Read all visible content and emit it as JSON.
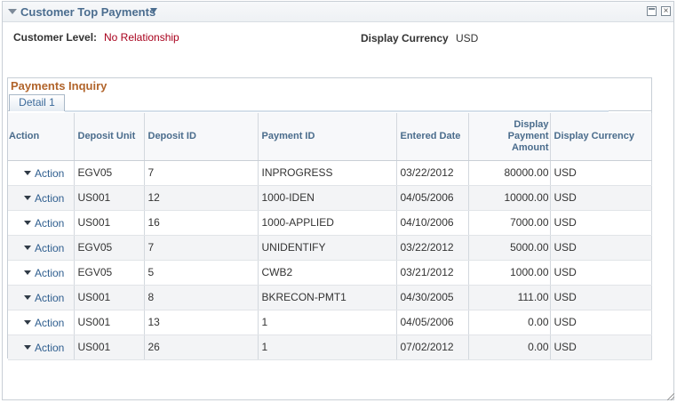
{
  "pagelet": {
    "title": "Customer Top Payments"
  },
  "info": {
    "customer_level_label": "Customer Level:",
    "customer_level_value": "No Relationship",
    "display_currency_label": "Display Currency",
    "display_currency_value": "USD"
  },
  "section": {
    "title": "Payments Inquiry",
    "tab_label": "Detail 1"
  },
  "grid": {
    "headers": {
      "action": "Action",
      "deposit_unit": "Deposit Unit",
      "deposit_id": "Deposit ID",
      "payment_id": "Payment ID",
      "entered_date": "Entered Date",
      "amount": "Display Payment Amount",
      "currency": "Display Currency"
    },
    "rows": [
      {
        "action": "Action",
        "deposit_unit": "EGV05",
        "deposit_id": "7",
        "payment_id": "INPROGRESS",
        "entered_date": "03/22/2012",
        "amount": "80000.00",
        "currency": "USD"
      },
      {
        "action": "Action",
        "deposit_unit": "US001",
        "deposit_id": "12",
        "payment_id": "1000-IDEN",
        "entered_date": "04/05/2006",
        "amount": "10000.00",
        "currency": "USD"
      },
      {
        "action": "Action",
        "deposit_unit": "US001",
        "deposit_id": "16",
        "payment_id": "1000-APPLIED",
        "entered_date": "04/10/2006",
        "amount": "7000.00",
        "currency": "USD"
      },
      {
        "action": "Action",
        "deposit_unit": "EGV05",
        "deposit_id": "7",
        "payment_id": "UNIDENTIFY",
        "entered_date": "03/22/2012",
        "amount": "5000.00",
        "currency": "USD"
      },
      {
        "action": "Action",
        "deposit_unit": "EGV05",
        "deposit_id": "5",
        "payment_id": "CWB2",
        "entered_date": "03/21/2012",
        "amount": "1000.00",
        "currency": "USD"
      },
      {
        "action": "Action",
        "deposit_unit": "US001",
        "deposit_id": "8",
        "payment_id": "BKRECON-PMT1",
        "entered_date": "04/30/2005",
        "amount": "111.00",
        "currency": "USD"
      },
      {
        "action": "Action",
        "deposit_unit": "US001",
        "deposit_id": "13",
        "payment_id": "1",
        "entered_date": "04/05/2006",
        "amount": "0.00",
        "currency": "USD"
      },
      {
        "action": "Action",
        "deposit_unit": "US001",
        "deposit_id": "26",
        "payment_id": "1",
        "entered_date": "07/02/2012",
        "amount": "0.00",
        "currency": "USD"
      }
    ]
  }
}
